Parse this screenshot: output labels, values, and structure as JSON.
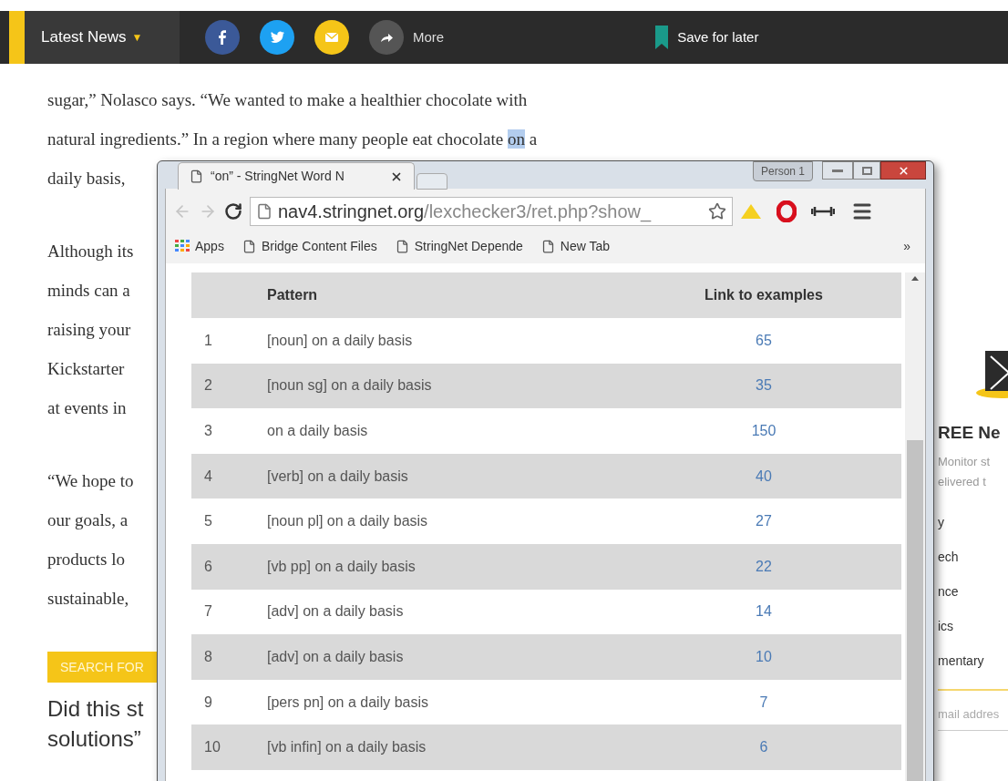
{
  "top_bar": {
    "section_menu": {
      "label": "Latest News",
      "caret": "▼"
    },
    "share_buttons": [
      {
        "kind": "facebook"
      },
      {
        "kind": "twitter"
      },
      {
        "kind": "email"
      },
      {
        "kind": "share"
      }
    ],
    "more_label": "More",
    "save_button": {
      "label": "Save for later"
    }
  },
  "article": {
    "paragraphs": [
      {
        "lines": [
          {
            "text": "sugar,” Nolasco says. “We wanted to make a healthier chocolate with"
          },
          {
            "text": "natural ingredients.” In a region where many people eat chocolate ",
            "selection": "on",
            "text_after": " a"
          },
          {
            "text": "daily basis,"
          }
        ]
      },
      {
        "lines": [
          {
            "text": "Although its"
          },
          {
            "text": "minds can a"
          },
          {
            "text": "raising your"
          },
          {
            "text": "Kickstarter"
          },
          {
            "text": "at events in"
          }
        ]
      },
      {
        "lines": [
          {
            "text": "“We hope to"
          },
          {
            "text": "our goals, a"
          },
          {
            "text": "products lo"
          },
          {
            "text": "sustainable,"
          }
        ]
      }
    ],
    "search_button": "SEARCH FOR",
    "question": [
      "Did this st",
      "solutions”"
    ]
  },
  "sidebar": {
    "title": "REE Ne",
    "description": [
      "Monitor st",
      "elivered t"
    ],
    "options": [
      "y",
      "ech",
      "nce",
      "ics",
      "mentary"
    ],
    "email_placeholder": "mail addres"
  },
  "browser": {
    "tab": {
      "title": "“on” - StringNet Word N"
    },
    "profile_button": "Person 1",
    "back_disabled": true,
    "forward_disabled": true,
    "address": {
      "domain": "nav4.stringnet.org",
      "path": "/lexchecker3/ret.php?show_"
    },
    "bookmarks": [
      {
        "kind": "apps",
        "label": "Apps"
      },
      {
        "kind": "page",
        "label": "Bridge Content Files"
      },
      {
        "kind": "page",
        "label": "StringNet Depende"
      },
      {
        "kind": "page",
        "label": "New Tab"
      }
    ],
    "bookmarks_overflow": "»",
    "table": {
      "columns": [
        "Pattern",
        "Link to examples"
      ],
      "rows": [
        {
          "number": "1",
          "pattern": "[noun] on a daily basis",
          "examples": "65"
        },
        {
          "number": "2",
          "pattern": "[noun sg] on a daily basis",
          "examples": "35"
        },
        {
          "number": "3",
          "pattern": "on a daily basis",
          "examples": "150"
        },
        {
          "number": "4",
          "pattern": "[verb] on a daily basis",
          "examples": "40"
        },
        {
          "number": "5",
          "pattern": "[noun pl] on a daily basis",
          "examples": "27"
        },
        {
          "number": "6",
          "pattern": "[vb pp] on a daily basis",
          "examples": "22"
        },
        {
          "number": "7",
          "pattern": "[adv] on a daily basis",
          "examples": "14"
        },
        {
          "number": "8",
          "pattern": "[adv] on a daily basis",
          "examples": "10"
        },
        {
          "number": "9",
          "pattern": "[pers pn] on a daily basis",
          "examples": "7"
        },
        {
          "number": "10",
          "pattern": "[vb infin] on a daily basis",
          "examples": "6"
        }
      ]
    }
  }
}
